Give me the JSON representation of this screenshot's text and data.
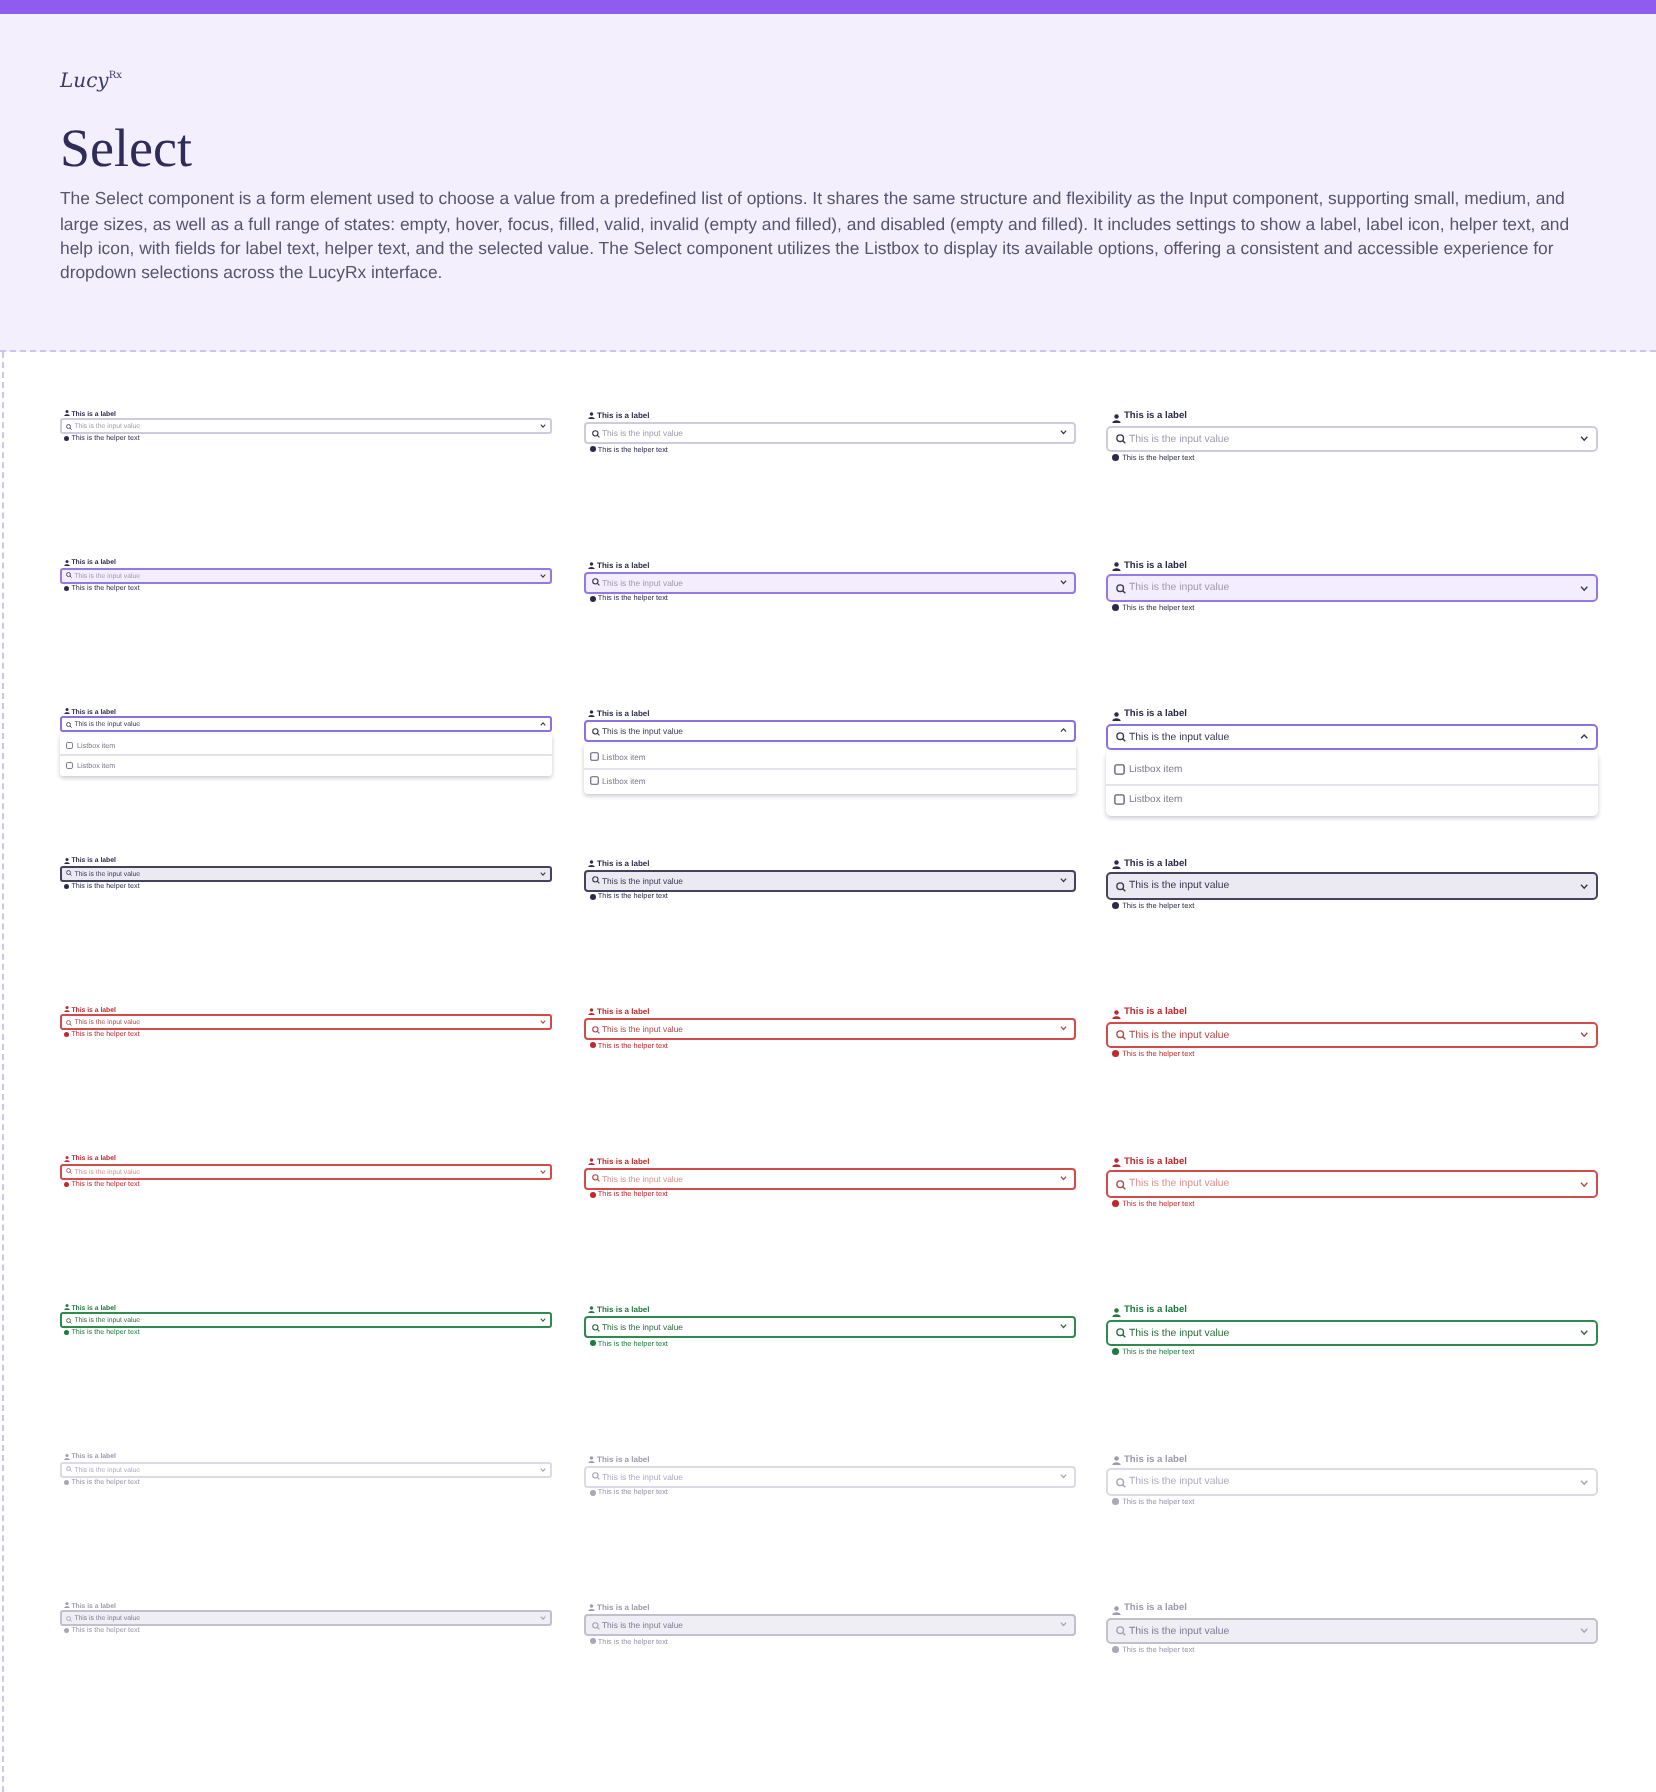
{
  "header": {
    "logo": "Lucy$^{Rx}$",
    "title": "Select",
    "description": "The Select component is a form element used to choose a value from a predefined list of options. It shares the same structure and flexibility as the Input component, supporting small, medium, and large sizes, as well as a full range of states: empty, hover, focus, filled, valid, invalid (empty and filled), and disabled (empty and filled). It includes settings to show a label, label icon, helper text, and help icon, with fields for label text, helper text, and the selected value. The Select component utilizes the Listbox to display its available options, offering a consistent and accessible experience for dropdown selections across the LucyRx interface."
  },
  "rows": [
    {
      "kind": "default",
      "fields": [
        {
          "kind": "small",
          "label": "This is a label",
          "placeholder": "This is the input value",
          "helper": "This is the helper text",
          "expanded": false
        },
        {
          "kind": "medium",
          "label": "This is a label",
          "placeholder": "This is the input value",
          "helper": "This is the helper text",
          "expanded": false
        },
        {
          "kind": "large",
          "label": "This is a label",
          "placeholder": "This is the input value",
          "helper": "This is the helper text",
          "expanded": false
        }
      ]
    },
    {
      "kind": "hover",
      "fields": [
        {
          "kind": "small",
          "label": "This is a label",
          "placeholder": "This is the input value",
          "helper": "This is the helper text",
          "expanded": false
        },
        {
          "kind": "medium",
          "label": "This is a label",
          "placeholder": "This is the input value",
          "helper": "This is the helper text",
          "expanded": false
        },
        {
          "kind": "large",
          "label": "This is a label",
          "placeholder": "This is the input value",
          "helper": "This is the helper text",
          "expanded": false
        }
      ]
    },
    {
      "kind": "focus",
      "fields": [
        {
          "kind": "small",
          "label": "This is a label",
          "value": "This is the input value",
          "expanded": true,
          "options": [
            {
              "label": "Listbox item",
              "checked": false
            },
            {
              "label": "Listbox item",
              "checked": false
            }
          ]
        },
        {
          "kind": "medium",
          "label": "This is a label",
          "value": "This is the input value",
          "expanded": true,
          "options": [
            {
              "label": "Listbox item",
              "checked": false
            },
            {
              "label": "Listbox item",
              "checked": false
            }
          ]
        },
        {
          "kind": "large",
          "label": "This is a label",
          "value": "This is the input value",
          "expanded": true,
          "options": [
            {
              "label": "Listbox item",
              "checked": false
            },
            {
              "label": "Listbox item",
              "checked": false
            }
          ]
        }
      ]
    },
    {
      "kind": "filled",
      "fields": [
        {
          "kind": "small",
          "label": "This is a label",
          "value": "This is the input value",
          "helper": "This is the helper text",
          "expanded": false
        },
        {
          "kind": "medium",
          "label": "This is a label",
          "value": "This is the input value",
          "helper": "This is the helper text",
          "expanded": false
        },
        {
          "kind": "large",
          "label": "This is a label",
          "value": "This is the input value",
          "helper": "This is the helper text",
          "expanded": false
        }
      ]
    },
    {
      "kind": "invalid",
      "fields": [
        {
          "kind": "small",
          "label": "This is a label",
          "value": "This is the input value",
          "helper": "This is the helper text",
          "expanded": false
        },
        {
          "kind": "medium",
          "label": "This is a label",
          "value": "This is the input value",
          "helper": "This is the helper text",
          "expanded": false
        },
        {
          "kind": "large",
          "label": "This is a label",
          "value": "This is the input value",
          "helper": "This is the helper text",
          "expanded": false
        }
      ]
    },
    {
      "kind": "invalid",
      "fields": [
        {
          "kind": "small",
          "label": "This is a label",
          "placeholder": "This is the input value",
          "helper": "This is the helper text",
          "expanded": false
        },
        {
          "kind": "medium",
          "label": "This is a label",
          "placeholder": "This is the input value",
          "helper": "This is the helper text",
          "expanded": false
        },
        {
          "kind": "large",
          "label": "This is a label",
          "placeholder": "This is the input value",
          "helper": "This is the helper text",
          "expanded": false
        }
      ]
    },
    {
      "kind": "valid",
      "fields": [
        {
          "kind": "small",
          "label": "This is a label",
          "value": "This is the input value",
          "helper": "This is the helper text",
          "expanded": false
        },
        {
          "kind": "medium",
          "label": "This is a label",
          "value": "This is the input value",
          "helper": "This is the helper text",
          "expanded": false
        },
        {
          "kind": "large",
          "label": "This is a label",
          "value": "This is the input value",
          "helper": "This is the helper text",
          "expanded": false
        }
      ]
    },
    {
      "kind": "disabled",
      "fields": [
        {
          "kind": "small",
          "label": "This is a label",
          "placeholder": "This is the input value",
          "helper": "This is the helper text",
          "expanded": false
        },
        {
          "kind": "medium",
          "label": "This is a label",
          "placeholder": "This is the input value",
          "helper": "This is the helper text",
          "expanded": false
        },
        {
          "kind": "large",
          "label": "This is a label",
          "placeholder": "This is the input value",
          "helper": "This is the helper text",
          "expanded": false
        }
      ]
    },
    {
      "kind": "disabled",
      "fields": [
        {
          "kind": "small",
          "label": "This is a label",
          "value": "This is the input value",
          "helper": "This is the helper text",
          "expanded": false
        },
        {
          "kind": "medium",
          "label": "This is a label",
          "value": "This is the input value",
          "helper": "This is the helper text",
          "expanded": false
        },
        {
          "kind": "large",
          "label": "This is a label",
          "value": "This is the input value",
          "helper": "This is the helper text",
          "expanded": false
        }
      ]
    }
  ]
}
